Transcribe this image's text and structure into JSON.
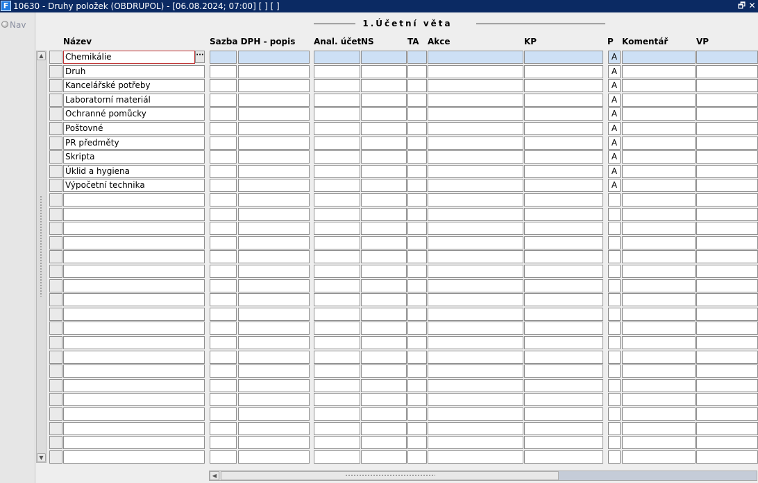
{
  "window": {
    "title": "10630 - Druhy položek (OBDRUPOL) - [06.08.2024; 07:00]  [ ]  [ ]",
    "restore_glyph": "🗗",
    "close_glyph": "✕"
  },
  "nav": {
    "label": "Nav"
  },
  "section": {
    "title": "1.Účetní věta"
  },
  "columns": [
    {
      "key": "nazev",
      "label": "Název"
    },
    {
      "key": "sazba",
      "label": "Sazba DPH - popis"
    },
    {
      "key": "anal",
      "label": "Anal. účet"
    },
    {
      "key": "ns",
      "label": "NS"
    },
    {
      "key": "ta",
      "label": "TA"
    },
    {
      "key": "akce",
      "label": "Akce"
    },
    {
      "key": "kp",
      "label": "KP"
    },
    {
      "key": "p",
      "label": "P"
    },
    {
      "key": "komentar",
      "label": "Komentář"
    },
    {
      "key": "vp",
      "label": "VP"
    }
  ],
  "rows": [
    {
      "nazev": "Chemikálie",
      "p": "A"
    },
    {
      "nazev": "Druh",
      "p": "A"
    },
    {
      "nazev": "Kancelářské potřeby",
      "p": "A"
    },
    {
      "nazev": "Laboratorní materiál",
      "p": "A"
    },
    {
      "nazev": "Ochranné pomůcky",
      "p": "A"
    },
    {
      "nazev": "Poštovné",
      "p": "A"
    },
    {
      "nazev": "PR předměty",
      "p": "A"
    },
    {
      "nazev": "Skripta",
      "p": "A"
    },
    {
      "nazev": "Úklid a hygiena",
      "p": "A"
    },
    {
      "nazev": "Výpočetní technika",
      "p": "A"
    },
    {
      "nazev": "",
      "p": ""
    },
    {
      "nazev": "",
      "p": ""
    },
    {
      "nazev": "",
      "p": ""
    },
    {
      "nazev": "",
      "p": ""
    },
    {
      "nazev": "",
      "p": ""
    },
    {
      "nazev": "",
      "p": ""
    },
    {
      "nazev": "",
      "p": ""
    },
    {
      "nazev": "",
      "p": ""
    },
    {
      "nazev": "",
      "p": ""
    },
    {
      "nazev": "",
      "p": ""
    },
    {
      "nazev": "",
      "p": ""
    },
    {
      "nazev": "",
      "p": ""
    },
    {
      "nazev": "",
      "p": ""
    },
    {
      "nazev": "",
      "p": ""
    },
    {
      "nazev": "",
      "p": ""
    },
    {
      "nazev": "",
      "p": ""
    },
    {
      "nazev": "",
      "p": ""
    },
    {
      "nazev": "",
      "p": ""
    },
    {
      "nazev": "",
      "p": ""
    }
  ],
  "active_row_index": 0,
  "lov_button_label": "···",
  "colors": {
    "titlebar": "#0b2a63",
    "selected_row": "#cde0f5",
    "active_cell_border": "#c03030"
  }
}
